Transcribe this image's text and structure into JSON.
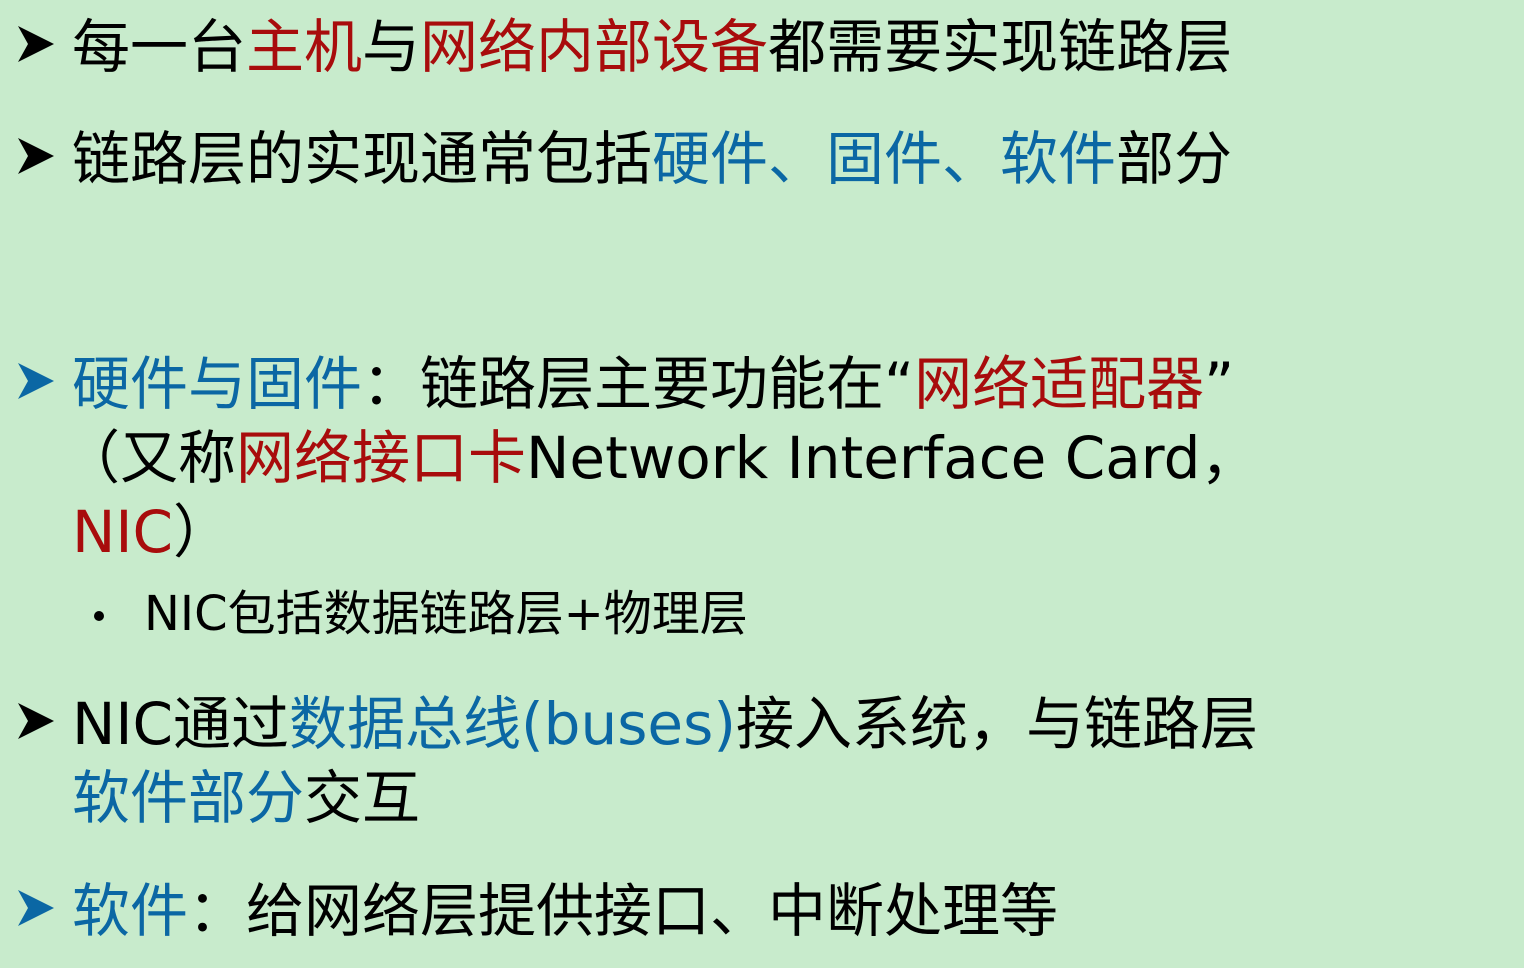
{
  "colors": {
    "background": "#c8ebcc",
    "highlight_red": "#a80c0c",
    "highlight_blue": "#0b67a4",
    "text": "#000000"
  },
  "icons": {
    "bullet": "arrow-bullet-icon",
    "sub_bullet": "round-dot-icon"
  },
  "bullets": [
    {
      "segments": [
        "每一台",
        "主机",
        "与",
        "网络内部设备",
        "都需要实现链路层"
      ]
    },
    {
      "segments": [
        "链路层的实现通常包括",
        "硬件、固件、软件",
        "部分"
      ]
    },
    {
      "segments": [
        "硬件与固件",
        "：链路层主要功能在“",
        "网络适配器",
        "”",
        "（又称",
        "网络接口卡",
        "Network Interface Card，",
        "NIC",
        "）"
      ]
    },
    {
      "segments": [
        "NIC通过",
        "数据总线(buses)",
        "接入系统，与链路层",
        "软件部分",
        "交互"
      ]
    },
    {
      "segments": [
        "软件",
        "：给网络层提供接口、中断处理等"
      ]
    }
  ],
  "sub_bullets": [
    {
      "text": "NIC包括数据链路层+物理层"
    }
  ]
}
